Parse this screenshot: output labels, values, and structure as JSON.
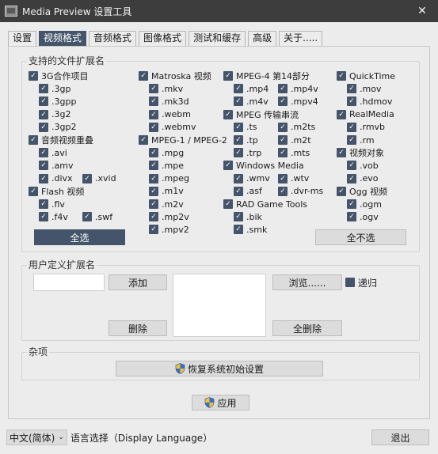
{
  "window": {
    "title": "Media Preview 设置工具",
    "close_glyph": "✕"
  },
  "tabs": [
    {
      "label": "设置",
      "active": false
    },
    {
      "label": "视频格式",
      "active": true
    },
    {
      "label": "音频格式",
      "active": false
    },
    {
      "label": "图像格式",
      "active": false
    },
    {
      "label": "测试和缓存",
      "active": false
    },
    {
      "label": "高级",
      "active": false
    },
    {
      "label": "关于.....",
      "active": false
    }
  ],
  "supported": {
    "title": "支持的文件扩展名",
    "col1": [
      {
        "label": "3G合作项目",
        "checked": true,
        "group": true
      },
      {
        "label": ".3gp",
        "checked": true
      },
      {
        "label": ".3gpp",
        "checked": true
      },
      {
        "label": ".3g2",
        "checked": true
      },
      {
        "label": ".3gp2",
        "checked": true
      },
      {
        "label": "音频视频重叠",
        "checked": true,
        "group": true
      },
      {
        "label": ".avi",
        "checked": true
      },
      {
        "label": ".amv",
        "checked": true
      },
      {
        "label": ".divx",
        "checked": true
      },
      {
        "label": ".xvid",
        "checked": true
      },
      {
        "label": "Flash 视频",
        "checked": true,
        "group": true
      },
      {
        "label": ".flv",
        "checked": true
      },
      {
        "label": ".f4v",
        "checked": true
      },
      {
        "label": ".swf",
        "checked": true
      }
    ],
    "col2": [
      {
        "label": "Matroska 视频",
        "checked": true,
        "group": true
      },
      {
        "label": ".mkv",
        "checked": true
      },
      {
        "label": ".mk3d",
        "checked": true
      },
      {
        "label": ".webm",
        "checked": true
      },
      {
        "label": ".webmv",
        "checked": true
      },
      {
        "label": "MPEG-1 / MPEG-2",
        "checked": true,
        "group": true
      },
      {
        "label": ".mpg",
        "checked": true
      },
      {
        "label": ".mpe",
        "checked": true
      },
      {
        "label": ".mpeg",
        "checked": true
      },
      {
        "label": ".m1v",
        "checked": true
      },
      {
        "label": ".m2v",
        "checked": true
      },
      {
        "label": ".mp2v",
        "checked": true
      },
      {
        "label": ".mpv2",
        "checked": true
      }
    ],
    "col3": [
      {
        "label": "MPEG-4 第14部分",
        "checked": true,
        "group": true
      },
      {
        "label": ".mp4",
        "checked": true
      },
      {
        "label": ".mp4v",
        "checked": true
      },
      {
        "label": ".m4v",
        "checked": true
      },
      {
        "label": ".mpv4",
        "checked": true
      },
      {
        "label": "MPEG 传输串流",
        "checked": true,
        "group": true
      },
      {
        "label": ".ts",
        "checked": true
      },
      {
        "label": ".m2ts",
        "checked": true
      },
      {
        "label": ".tp",
        "checked": true
      },
      {
        "label": ".m2t",
        "checked": true
      },
      {
        "label": ".trp",
        "checked": true
      },
      {
        "label": ".mts",
        "checked": true
      },
      {
        "label": "Windows Media",
        "checked": true,
        "group": true
      },
      {
        "label": ".wmv",
        "checked": true
      },
      {
        "label": ".wtv",
        "checked": true
      },
      {
        "label": ".asf",
        "checked": true
      },
      {
        "label": ".dvr-ms",
        "checked": true
      },
      {
        "label": "RAD Game Tools",
        "checked": true,
        "group": true
      },
      {
        "label": ".bik",
        "checked": true
      },
      {
        "label": ".smk",
        "checked": true
      }
    ],
    "col4": [
      {
        "label": "QuickTime",
        "checked": true,
        "group": true
      },
      {
        "label": ".mov",
        "checked": true
      },
      {
        "label": ".hdmov",
        "checked": true
      },
      {
        "label": "RealMedia",
        "checked": true,
        "group": true
      },
      {
        "label": ".rmvb",
        "checked": true
      },
      {
        "label": ".rm",
        "checked": true
      },
      {
        "label": "视频对象",
        "checked": true,
        "group": true
      },
      {
        "label": ".vob",
        "checked": true
      },
      {
        "label": ".evo",
        "checked": true
      },
      {
        "label": "Ogg 视频",
        "checked": true,
        "group": true
      },
      {
        "label": ".ogm",
        "checked": true
      },
      {
        "label": ".ogv",
        "checked": true
      }
    ],
    "select_all": "全选",
    "select_none": "全不选"
  },
  "custom": {
    "title": "用户定义扩展名",
    "input_value": "",
    "add": "添加",
    "remove": "删除",
    "browse": "浏览......",
    "remove_all": "全删除",
    "recursive_label": "递归",
    "recursive_checked": false
  },
  "misc": {
    "title": "杂项",
    "reset": "恢复系统初始设置"
  },
  "apply": "应用",
  "language": {
    "selected": "中文(简体)",
    "label": "语言选择（Display Language）"
  },
  "exit": "退出",
  "colors": {
    "accent": "#44546a",
    "titlebar": "#3d3d3d",
    "background": "#ececec"
  }
}
